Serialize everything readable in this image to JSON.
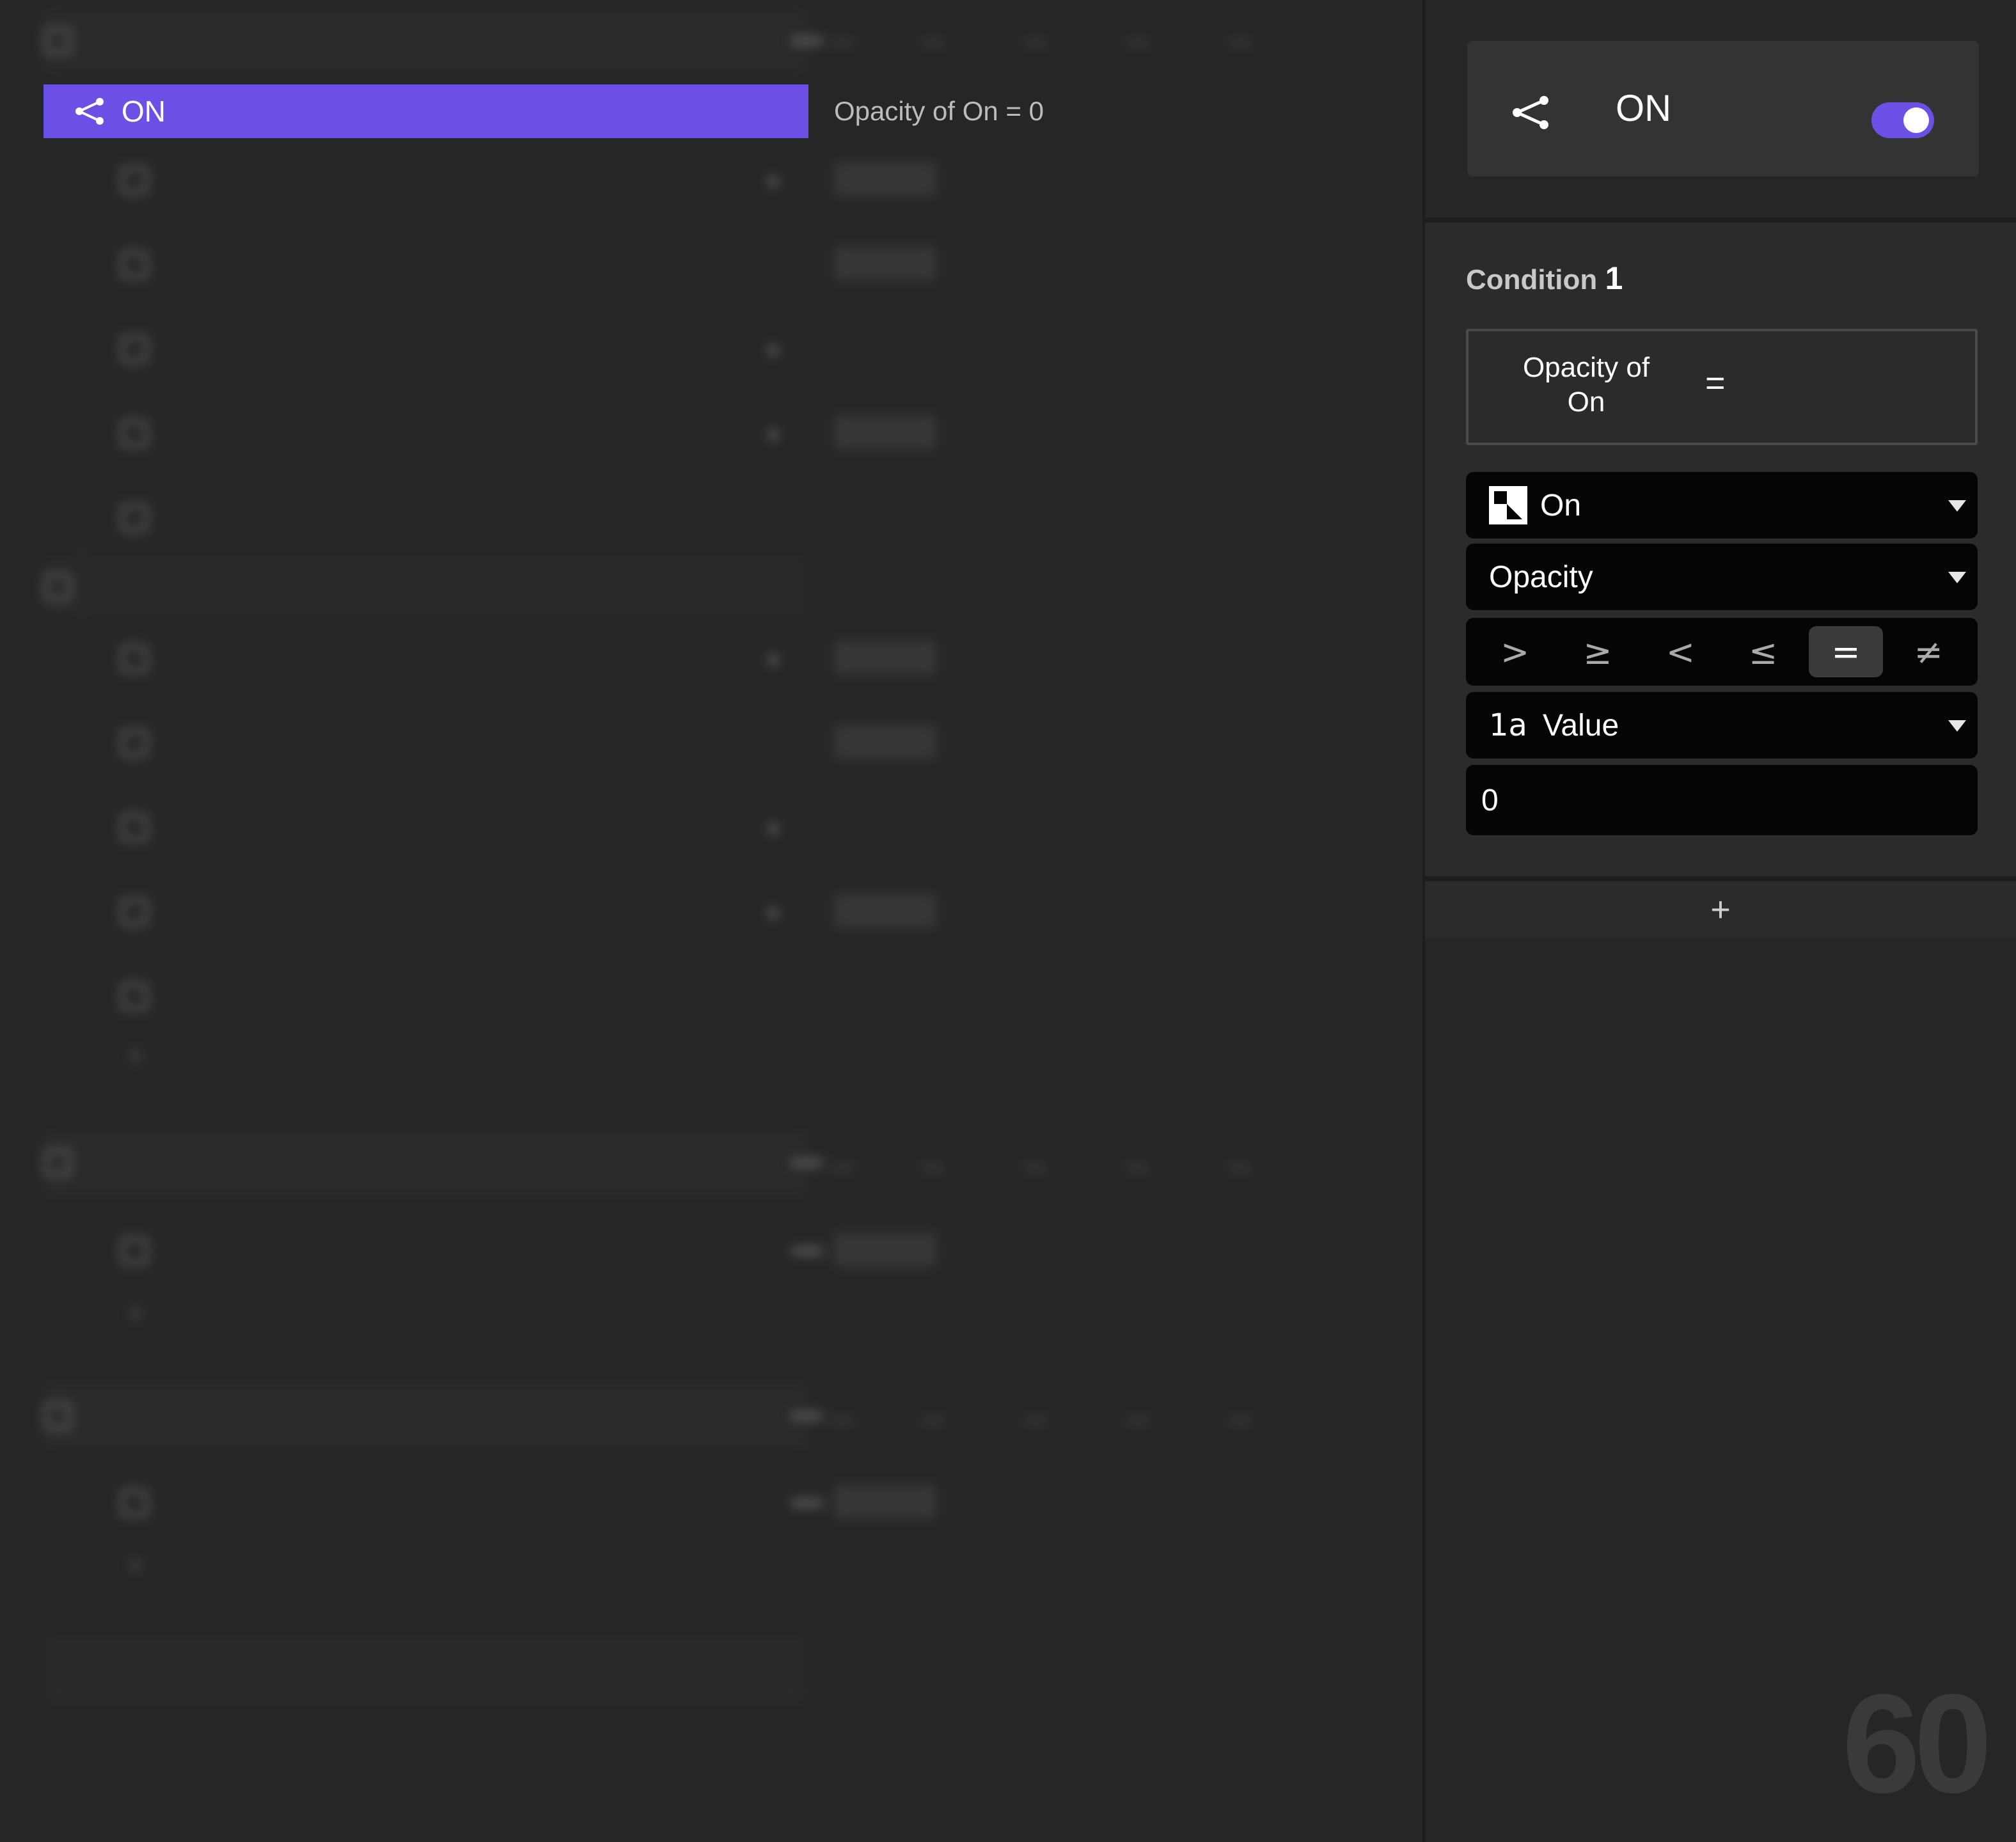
{
  "colors": {
    "accent": "#6c4fe4",
    "background": "#262626",
    "panel": "#2b2b2b",
    "field": "#050505"
  },
  "trigger_list": {
    "selected_row": {
      "icon": "branch-icon",
      "label": "ON",
      "summary": "Opacity of On = 0"
    }
  },
  "inspector": {
    "header": {
      "icon": "branch-icon",
      "title": "ON",
      "toggle_on": true
    },
    "condition": {
      "title": "Condition",
      "number": "1",
      "summary_subject": "Opacity of On",
      "summary_operator": "=",
      "layer_dropdown": {
        "icon": "layer-icon",
        "value": "On"
      },
      "property_dropdown": {
        "value": "Opacity"
      },
      "operators": [
        ">",
        "≥",
        "<",
        "≤",
        "=",
        "≠"
      ],
      "active_operator": "=",
      "source_dropdown": {
        "icon": "value-type-icon",
        "icon_text": "1a",
        "value": "Value"
      },
      "value_input": "0"
    },
    "add_condition_label": "+"
  },
  "fps_counter": "60"
}
